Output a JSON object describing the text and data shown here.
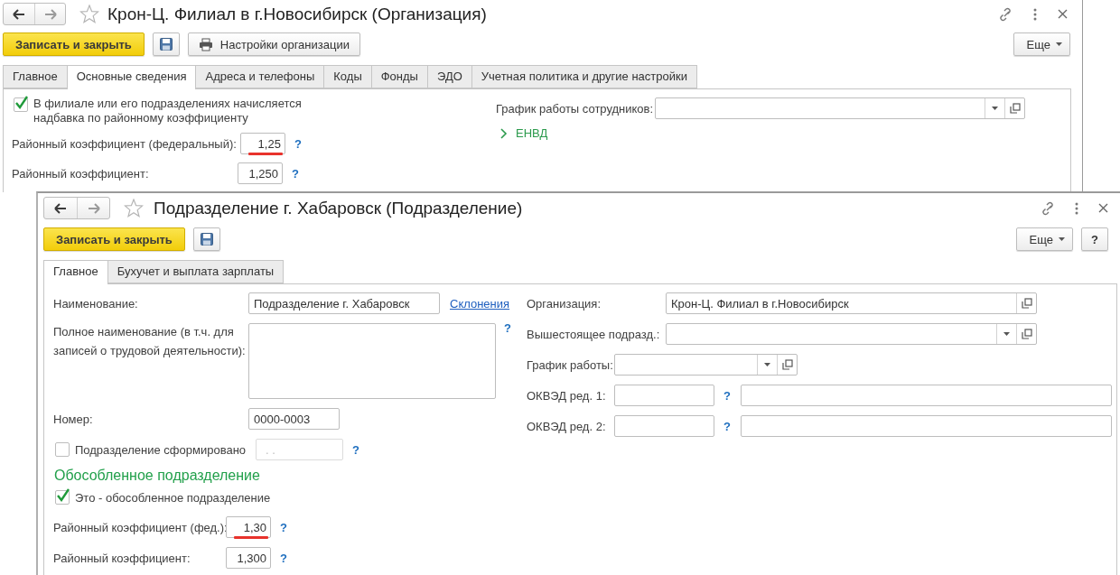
{
  "org_window": {
    "title": "Крон-Ц. Филиал в г.Новосибирск (Организация)",
    "toolbar": [
      {
        "kind": "primary",
        "label": "Записать и закрыть"
      },
      {
        "kind": "save"
      },
      {
        "kind": "print",
        "label": "Настройки организации"
      }
    ],
    "more_button": "Еще",
    "tabs": [
      {
        "label": "Главное",
        "selected": false
      },
      {
        "label": "Основные сведения",
        "selected": true
      },
      {
        "label": "Адреса и телефоны",
        "selected": false
      },
      {
        "label": "Коды",
        "selected": false
      },
      {
        "label": "Фонды",
        "selected": false
      },
      {
        "label": "ЭДО",
        "selected": false
      },
      {
        "label": "Учетная политика и другие настройки",
        "selected": false
      }
    ],
    "checkbox": {
      "label": "В филиале или его подразделениях начисляется надбавка по районному коэффициенту",
      "checked": true
    },
    "coefficients": [
      {
        "label": "Районный коэффициент (федеральный):",
        "value": "1,25",
        "help": "?",
        "underlined": true
      },
      {
        "label": "Районный коэффициент:",
        "value": "1,250",
        "help": "?",
        "underlined": false
      }
    ],
    "schedule": {
      "label": "График работы сотрудников:"
    },
    "group": {
      "label": "ЕНВД",
      "expanded": false
    }
  },
  "unit_window": {
    "title": "Подразделение г. Хабаровск (Подразделение)",
    "toolbar": [
      {
        "kind": "primary",
        "label": "Записать и закрыть"
      },
      {
        "kind": "save"
      }
    ],
    "more_button": "Еще",
    "help_button": "?",
    "tabs": [
      {
        "label": "Главное",
        "selected": true
      },
      {
        "label": "Бухучет и выплата зарплаты",
        "selected": false
      }
    ],
    "name": {
      "label": "Наименование:",
      "value": "Подразделение г. Хабаровск",
      "link": "Склонения"
    },
    "full_name": {
      "label": "Полное наименование (в т.ч. для записей о трудовой деятельности):",
      "help": "?"
    },
    "number": {
      "label": "Номер:",
      "value": "0000-0003"
    },
    "formed": {
      "label": "Подразделение сформировано",
      "checked": false,
      "placeholder": ". .",
      "disabled": true,
      "help": "?"
    },
    "separate_section": {
      "title": "Обособленное подразделение",
      "checkbox": {
        "label": "Это - обособленное подразделение",
        "checked": true
      },
      "coefficients": [
        {
          "label": "Районный коэффициент (фед.):",
          "value": "1,30",
          "help": "?",
          "underlined": true
        },
        {
          "label": "Районный коэффициент:",
          "value": "1,300",
          "help": "?",
          "underlined": false
        }
      ]
    },
    "right_fields": [
      {
        "kind": "reference",
        "label": "Организация:",
        "value": "Крон-Ц. Филиал в г.Новосибирск"
      },
      {
        "kind": "select",
        "label": "Вышестоящее подразд.:"
      },
      {
        "kind": "select_short",
        "label": "График работы:"
      },
      {
        "kind": "code",
        "label": "ОКВЭД ред. 1:",
        "help": "?"
      },
      {
        "kind": "code",
        "label": "ОКВЭД ред. 2:",
        "help": "?"
      }
    ]
  }
}
